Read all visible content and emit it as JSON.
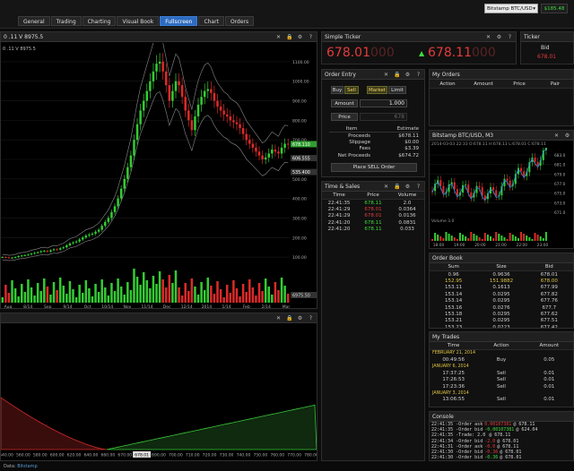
{
  "topbar": {
    "tabs": [
      "General",
      "Trading",
      "Charting",
      "Visual Book",
      "Fullscreen",
      "Chart",
      "Orders"
    ],
    "active_tab": 4,
    "market_select": "Bitstamp BTC/USD",
    "balance": "$185.48"
  },
  "big_chart": {
    "title": "0 .11 V 8975.5",
    "y_ticks": [
      "1100.00",
      "1000.00",
      "900.00",
      "800.00",
      "700.00",
      "600.00",
      "500.00",
      "400.00",
      "300.00",
      "200.00",
      "100.00"
    ],
    "price_tags": [
      "678.110",
      "606.555",
      "535.400"
    ],
    "volume_tag": "6975.50",
    "x_ticks": [
      "Aug",
      "8/14",
      "Sep",
      "9/14",
      "Oct",
      "10/14",
      "Nov",
      "11/14",
      "Dec",
      "12/14",
      "2014",
      "1/14",
      "Feb",
      "2/14",
      "Mar"
    ],
    "close_series": [
      100,
      98,
      96,
      97,
      100,
      105,
      108,
      110,
      113,
      118,
      122,
      125,
      130,
      132,
      128,
      135,
      140,
      138,
      145,
      150,
      160,
      170,
      175,
      180,
      190,
      200,
      210,
      215,
      220,
      230,
      240,
      260,
      280,
      300,
      330,
      360,
      400,
      450,
      500,
      560,
      620,
      700,
      780,
      850,
      900,
      950,
      1000,
      1050,
      1090,
      1100,
      1050,
      980,
      900,
      950,
      1000,
      980,
      920,
      850,
      800,
      750,
      820,
      880,
      920,
      950,
      960,
      940,
      900,
      870,
      850,
      830,
      820,
      800,
      790,
      780,
      760,
      730,
      700,
      680,
      660,
      640,
      620,
      600,
      610,
      630,
      650,
      640,
      630,
      660,
      680,
      678
    ]
  },
  "depth_chart": {
    "x_ticks": [
      "540.00",
      "560.00",
      "580.00",
      "600.00",
      "620.00",
      "640.00",
      "660.00",
      "670.00",
      "678.01",
      "690.00",
      "700.00",
      "710.00",
      "720.00",
      "730.00",
      "740.00",
      "750.00",
      "760.00",
      "770.00",
      "780.00"
    ],
    "highlight_tick": "678.01"
  },
  "simple_ticker": {
    "title": "Simple Ticker",
    "bid_main": "678.01",
    "bid_faded": "000",
    "ask_main": "678.11",
    "ask_faded": "000"
  },
  "ticker_small": {
    "title": "Ticker",
    "label": "Bid",
    "value": "678.01"
  },
  "order_entry": {
    "title": "Order Entry",
    "buy": "Buy",
    "sell": "Sell",
    "market": "Market",
    "limit": "Limit",
    "amount_label": "Amount",
    "amount_value": "1.000",
    "price_label": "Price",
    "price_value": "678",
    "item_header": "Item",
    "estimate_header": "Estimate",
    "rows": [
      {
        "item": "Proceeds",
        "value": "$678.11"
      },
      {
        "item": "Slippage",
        "value": "$0.00"
      },
      {
        "item": "Fees",
        "value": "$3.39"
      },
      {
        "item": "Net Proceeds",
        "value": "$674.72"
      }
    ],
    "submit": "Place SELL Order"
  },
  "time_sales": {
    "title": "Time & Sales",
    "headers": [
      "Time",
      "Price",
      "Volume"
    ],
    "rows": [
      {
        "time": "22:41:35",
        "price": "678.11",
        "vol": "2.0",
        "color": "green"
      },
      {
        "time": "22:41:29",
        "price": "678.01",
        "vol": "0.0364",
        "color": "red"
      },
      {
        "time": "22:41:29",
        "price": "678.01",
        "vol": "0.0136",
        "color": "red"
      },
      {
        "time": "22:41:20",
        "price": "678.11",
        "vol": "0.0831",
        "color": "green"
      },
      {
        "time": "22:41:20",
        "price": "678.11",
        "vol": "0.033",
        "color": "green"
      }
    ]
  },
  "my_orders": {
    "title": "My Orders",
    "headers": [
      "Action",
      "Amount",
      "Price",
      "Pair"
    ]
  },
  "mini_chart": {
    "title": "Bitstamp BTC/USD, M3",
    "info": "2014-03-03 22:33 O:678.11 H:678.11 L:678.01 C:678.11",
    "volume_label": "Volume 3.0",
    "y_ticks": [
      "683.0",
      "681.0",
      "679.0",
      "677.0",
      "675.0",
      "673.0",
      "671.0"
    ],
    "x_ticks": [
      "18:00",
      "19:00",
      "20:00",
      "21:00",
      "22:00",
      "23:00"
    ]
  },
  "order_book": {
    "title": "Order Book",
    "headers": [
      "Sum",
      "Size",
      "Bid"
    ],
    "rows": [
      {
        "sum": "0.96",
        "size": "0.9636",
        "bid": "678.01",
        "hl": false
      },
      {
        "sum": "152.95",
        "size": "151.9882",
        "bid": "678.00",
        "hl": true
      },
      {
        "sum": "153.11",
        "size": "0.1613",
        "bid": "677.99",
        "hl": false
      },
      {
        "sum": "153.14",
        "size": "0.0295",
        "bid": "677.82",
        "hl": false
      },
      {
        "sum": "153.14",
        "size": "0.0295",
        "bid": "677.76",
        "hl": false
      },
      {
        "sum": "153.16",
        "size": "0.0276",
        "bid": "677.7",
        "hl": false
      },
      {
        "sum": "153.18",
        "size": "0.0295",
        "bid": "677.62",
        "hl": false
      },
      {
        "sum": "153.21",
        "size": "0.0295",
        "bid": "677.51",
        "hl": false
      },
      {
        "sum": "153.23",
        "size": "0.0223",
        "bid": "677.42",
        "hl": false
      },
      {
        "sum": "153.24",
        "size": "0.0128",
        "bid": "677.31",
        "hl": false
      }
    ]
  },
  "my_trades": {
    "title": "My Trades",
    "headers": [
      "Time",
      "Action",
      "Amount"
    ],
    "groups": [
      {
        "date": "FEBRUARY 21, 2014",
        "rows": [
          {
            "time": "00:49:56",
            "action": "Buy",
            "amount": "0.05"
          }
        ]
      },
      {
        "date": "JANUARY 6, 2014",
        "rows": [
          {
            "time": "17:37:25",
            "action": "Sell",
            "amount": "0.01"
          },
          {
            "time": "17:26:53",
            "action": "Sell",
            "amount": "0.01"
          },
          {
            "time": "17:23:36",
            "action": "Sell",
            "amount": "0.01"
          }
        ]
      },
      {
        "date": "JANUARY 3, 2014",
        "rows": [
          {
            "time": "13:06:55",
            "action": "Sell",
            "amount": "0.01"
          }
        ]
      }
    ]
  },
  "console": {
    "title": "Console",
    "lines": [
      {
        "t": "22:41:35",
        "a": "Order ask",
        "v": "0.00107381",
        "b": "678.11",
        "c": "red"
      },
      {
        "t": "22:41:35",
        "a": "Order bid",
        "v": "-0.00107381",
        "b": "624.04",
        "c": "green"
      },
      {
        "t": "22:41:35",
        "a": "Trade: 2.0",
        "v": "",
        "b": "678.11",
        "c": "green"
      },
      {
        "t": "22:41:34",
        "a": "Order bid",
        "v": "-2.0",
        "b": "678.01",
        "c": "red"
      },
      {
        "t": "22:41:31",
        "a": "Order ask",
        "v": "-0.0",
        "b": "678.11",
        "c": "red"
      },
      {
        "t": "22:41:30",
        "a": "Order bid",
        "v": "-0.36",
        "b": "678.01",
        "c": "red"
      },
      {
        "t": "22:41:30",
        "a": "Order bid",
        "v": "-0.36",
        "b": "678.01",
        "c": "green"
      }
    ]
  },
  "footer": {
    "label": "Data:",
    "source": "Bitstamp"
  }
}
